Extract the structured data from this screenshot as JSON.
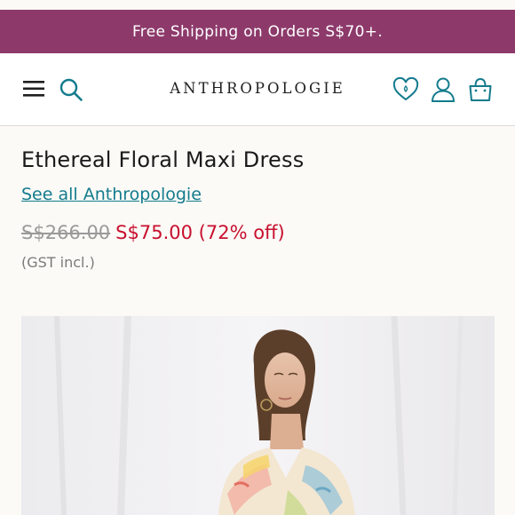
{
  "promo": {
    "text": "Free Shipping on Orders S$70+."
  },
  "header": {
    "logo": "ANTHROPOLOGIE",
    "icons": [
      "menu-icon",
      "search-icon",
      "wishlist-heart-icon",
      "account-icon",
      "shopping-bag-icon"
    ]
  },
  "product": {
    "title": "Ethereal Floral Maxi Dress",
    "brand_link": "See all Anthropologie",
    "original_price": "S$266.00",
    "sale_price": "S$75.00 (72% off)",
    "tax_note": "(GST incl.)"
  },
  "colors": {
    "promo_bg": "#8d3a6b",
    "link": "#137b8d",
    "sale_price": "#c8102e",
    "strikethrough": "#9a9a9a"
  }
}
